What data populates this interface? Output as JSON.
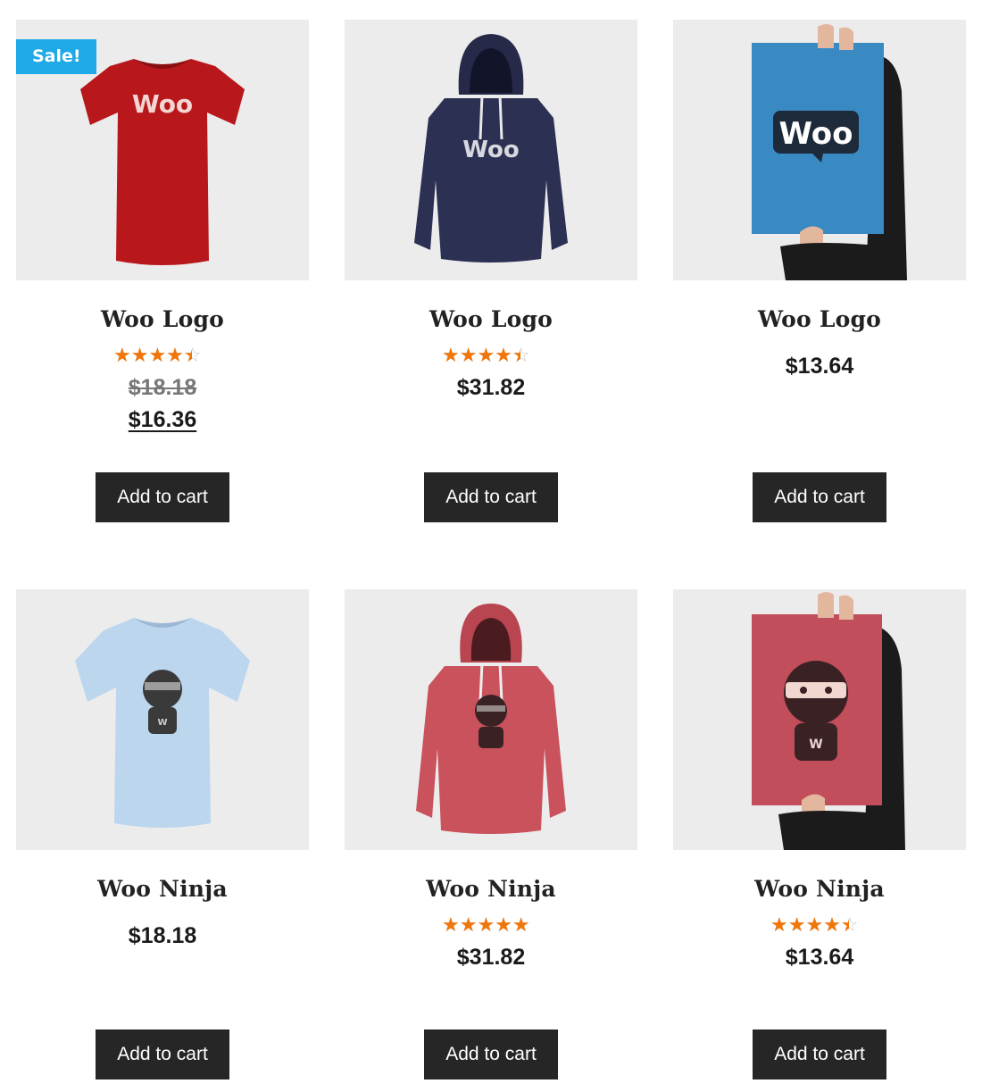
{
  "sale_badge": "Sale!",
  "button_label": "Add to cart",
  "colors": {
    "star_fill": "#f0760a",
    "sale_badge": "#1fa9e6",
    "button_bg": "#262626",
    "image_bg": "#ececec"
  },
  "products": [
    {
      "title": "Woo Logo",
      "image": "red-tshirt-woo-logo",
      "rating": 4,
      "price_old": "$18.18",
      "price": "$16.36",
      "on_sale": true
    },
    {
      "title": "Woo Logo",
      "image": "navy-hoodie-woo-logo",
      "rating": 4,
      "price": "$31.82"
    },
    {
      "title": "Woo Logo",
      "image": "blue-poster-woo-logo",
      "price": "$13.64"
    },
    {
      "title": "Woo Ninja",
      "image": "light-blue-tshirt-ninja",
      "price": "$18.18"
    },
    {
      "title": "Woo Ninja",
      "image": "red-hoodie-ninja",
      "rating": 4.5,
      "price": "$31.82"
    },
    {
      "title": "Woo Ninja",
      "image": "red-poster-ninja",
      "rating": 4,
      "price": "$13.64"
    }
  ]
}
